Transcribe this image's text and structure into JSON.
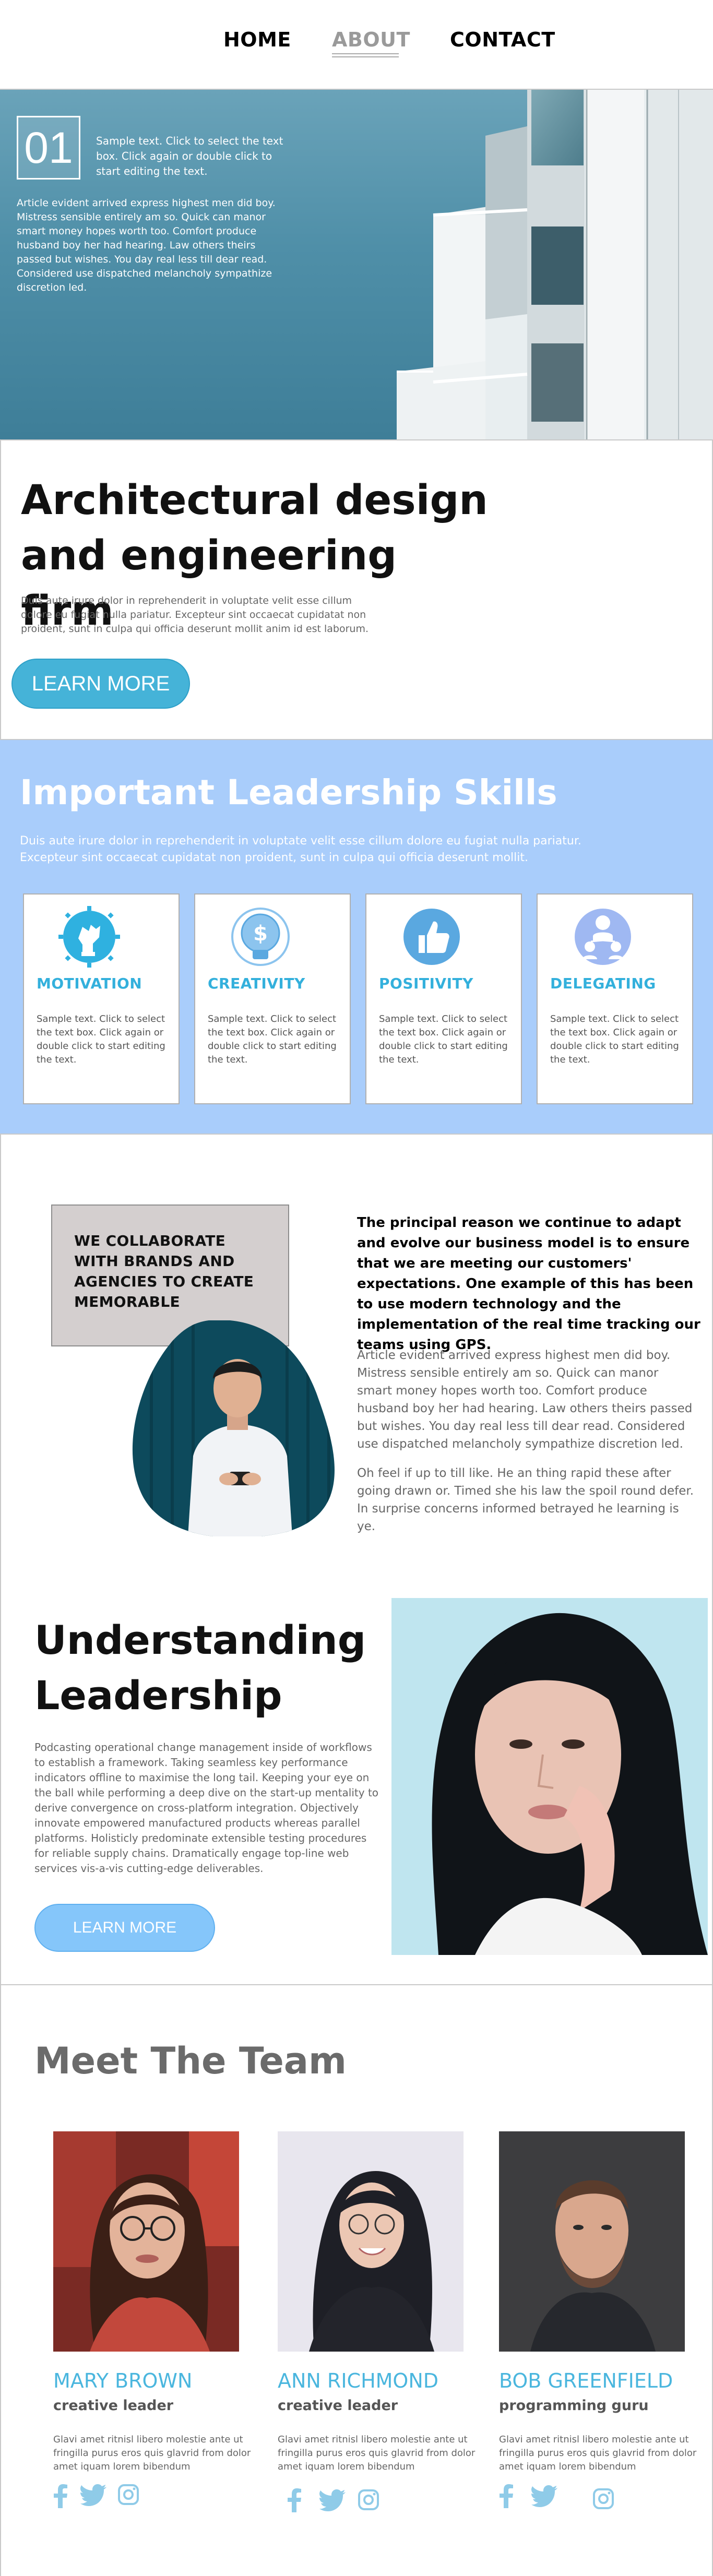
{
  "nav": {
    "home": "HOME",
    "about": "ABOUT",
    "contact": "CONTACT"
  },
  "hero": {
    "number": "01",
    "small_text": "Sample text. Click to select the text box. Click again or double click to start editing the text.",
    "paragraph": "Article evident arrived express highest men did boy. Mistress sensible entirely am so. Quick can manor smart money hopes worth too. Comfort produce husband boy her had hearing. Law others theirs passed but wishes. You day real less till dear read. Considered use dispatched melancholy sympathize discretion led."
  },
  "intro": {
    "title": "Architectural design and engineering firm",
    "text": "Duis aute irure dolor in reprehenderit in voluptate velit esse cillum dolore eu fugiat nulla pariatur. Excepteur sint occaecat cupidatat non proident, sunt in culpa qui officia deserunt mollit anim id est laborum.",
    "button": "LEARN MORE"
  },
  "skills": {
    "title": "Important Leadership Skills",
    "subtitle": "Duis aute irure dolor in reprehenderit in voluptate velit esse cillum dolore eu fugiat nulla pariatur. Excepteur sint occaecat cupidatat non proident, sunt in culpa qui officia deserunt mollit.",
    "cards": [
      {
        "title": "MOTIVATION",
        "icon": "motivation-icon",
        "text": "Sample text. Click to select the text box. Click again or double click to start editing the text."
      },
      {
        "title": "CREATIVITY",
        "icon": "creativity-icon",
        "text": "Sample text. Click to select the text box. Click again or double click to start editing the text."
      },
      {
        "title": "POSITIVITY",
        "icon": "positivity-icon",
        "text": "Sample text. Click to select the text box. Click again or double click to start editing the text."
      },
      {
        "title": "DELEGATING",
        "icon": "delegating-icon",
        "text": "Sample text. Click to select the text box. Click again or double click to start editing the text."
      }
    ]
  },
  "collab": {
    "box_text": "WE COLLABORATE WITH BRANDS AND AGENCIES TO CREATE MEMORABLE",
    "bold_text": "The principal reason we continue to adapt and evolve our business model is to ensure that we are meeting our customers' expectations. One example of this has been to use modern technology and the implementation of the real time tracking our teams using GPS.",
    "paragraph1": "Article evident arrived express highest men did boy. Mistress sensible entirely am so. Quick can manor smart money hopes worth too. Comfort produce husband boy her had hearing. Law others theirs passed but wishes. You day real less till dear read. Considered use dispatched melancholy sympathize discretion led.",
    "paragraph2": "Oh feel if up to till like. He an thing rapid these after going drawn or. Timed she his law the spoil round defer. In surprise concerns informed betrayed he learning is ye."
  },
  "leadership": {
    "title": "Understanding Leadership",
    "text": "Podcasting operational change management inside of workflows to establish a framework. Taking seamless key performance indicators offline to maximise the long tail. Keeping your eye on the ball while performing a deep dive on the start-up mentality to derive convergence on cross-platform integration. Objectively innovate empowered manufactured products whereas parallel platforms. Holisticly predominate extensible testing procedures for reliable supply chains. Dramatically engage top-line web services vis-a-vis cutting-edge deliverables.",
    "button": "LEARN MORE"
  },
  "team": {
    "title": "Meet The Team",
    "members": [
      {
        "name": "MARY BROWN",
        "role": "creative leader",
        "text": "Glavi amet ritnisl libero molestie ante ut fringilla purus eros quis glavrid from dolor amet iquam lorem bibendum"
      },
      {
        "name": "ANN RICHMOND",
        "role": "creative leader",
        "text": "Glavi amet ritnisl libero molestie ante ut fringilla purus eros quis glavrid from dolor amet iquam lorem bibendum"
      },
      {
        "name": "BOB GREENFIELD",
        "role": "programming guru",
        "text": "Glavi amet ritnisl libero molestie ante ut fringilla purus eros quis glavrid from dolor amet iquam lorem bibendum"
      }
    ],
    "social_icons": [
      "facebook-icon",
      "twitter-icon",
      "instagram-icon"
    ]
  },
  "colors": {
    "accent_blue": "#45b3d8",
    "skills_bg": "#a9cdfb",
    "card_title": "#33b0dc",
    "team_name": "#4ab6de",
    "light_button": "#85c6fa"
  }
}
